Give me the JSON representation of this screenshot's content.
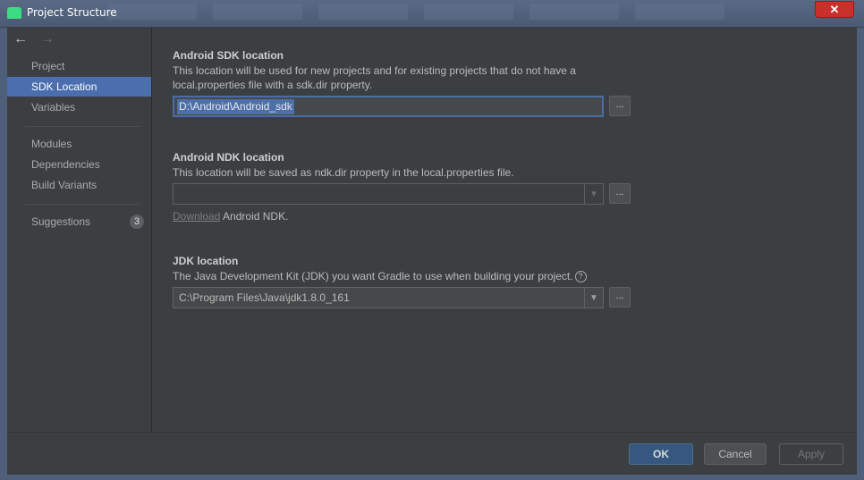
{
  "window": {
    "title": "Project Structure",
    "close_label": "✕"
  },
  "nav": {
    "back_glyph": "←",
    "forward_glyph": "→"
  },
  "sidebar": {
    "items": [
      {
        "label": "Project"
      },
      {
        "label": "SDK Location",
        "selected": true
      },
      {
        "label": "Variables"
      },
      {
        "label": "Modules"
      },
      {
        "label": "Dependencies"
      },
      {
        "label": "Build Variants"
      },
      {
        "label": "Suggestions",
        "badge": "3"
      }
    ]
  },
  "sdk": {
    "title": "Android SDK location",
    "desc_line1": "This location will be used for new projects and for existing projects that do not have a",
    "desc_line2": "local.properties file with a sdk.dir property.",
    "value": "D:\\Android\\Android_sdk",
    "browse_label": "..."
  },
  "ndk": {
    "title": "Android NDK location",
    "desc": "This location will be saved as ndk.dir property in the local.properties file.",
    "value": "",
    "browse_label": "...",
    "download_link": "Download",
    "download_rest": " Android NDK."
  },
  "jdk": {
    "title": "JDK location",
    "desc": "The Java Development Kit (JDK) you want Gradle to use when building your project.",
    "help_glyph": "?",
    "value": "C:\\Program Files\\Java\\jdk1.8.0_161",
    "browse_label": "..."
  },
  "footer": {
    "ok_label": "OK",
    "cancel_label": "Cancel",
    "apply_label": "Apply"
  },
  "colors": {
    "selection": "#4b6eaf",
    "ok_button": "#365880",
    "close_button": "#c9302c"
  }
}
